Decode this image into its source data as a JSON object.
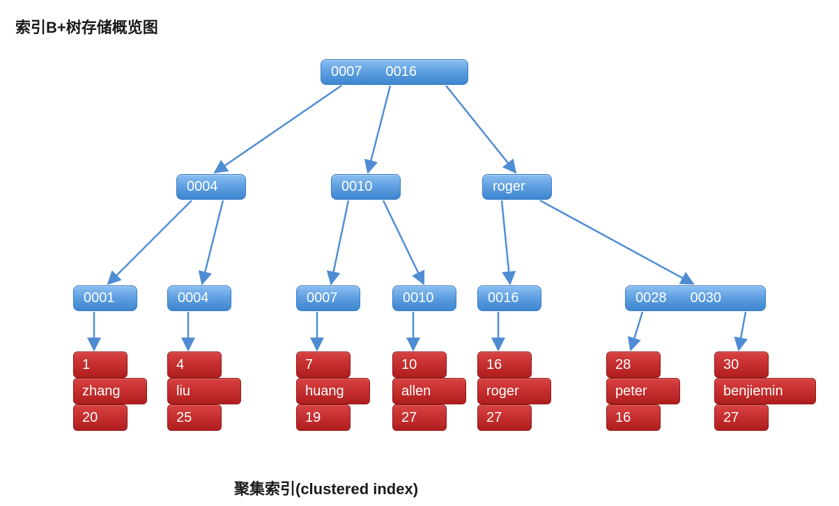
{
  "title": "索引B+树存储概览图",
  "caption": "聚集索引(clustered index)",
  "root": {
    "k1": "0007",
    "k2": "0016"
  },
  "level2": {
    "n1": "0004",
    "n2": "0010",
    "n3": "roger"
  },
  "leaves": {
    "l1": "0001",
    "l2": "0004",
    "l3": "0007",
    "l4": "0010",
    "l5": "0016",
    "l6a": "0028",
    "l6b": "0030"
  },
  "rows": {
    "r1": {
      "id": "1",
      "name": "zhang",
      "age": "20"
    },
    "r2": {
      "id": "4",
      "name": "liu",
      "age": "25"
    },
    "r3": {
      "id": "7",
      "name": "huang",
      "age": "19"
    },
    "r4": {
      "id": "10",
      "name": "allen",
      "age": "27"
    },
    "r5": {
      "id": "16",
      "name": "roger",
      "age": "27"
    },
    "r6": {
      "id": "28",
      "name": "peter",
      "age": "16"
    },
    "r7": {
      "id": "30",
      "name": "benjiemin",
      "age": "27"
    }
  }
}
